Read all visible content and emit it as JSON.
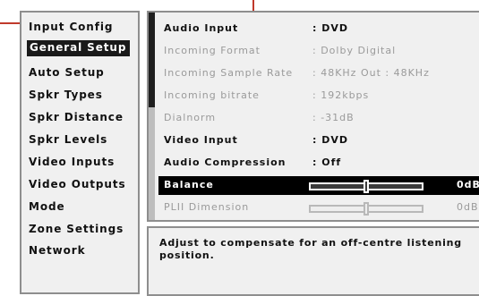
{
  "menu": {
    "items": [
      {
        "label": "Input Config"
      },
      {
        "label": "General Setup"
      },
      {
        "label": "Auto Setup"
      },
      {
        "label": "Spkr Types"
      },
      {
        "label": "Spkr Distance"
      },
      {
        "label": "Spkr Levels"
      },
      {
        "label": "Video Inputs"
      },
      {
        "label": "Video Outputs"
      },
      {
        "label": "Mode"
      },
      {
        "label": "Zone Settings"
      },
      {
        "label": "Network"
      }
    ],
    "selected": "General Setup"
  },
  "settings": {
    "rows": [
      {
        "label": "Audio Input",
        "value": ": DVD",
        "state": "active"
      },
      {
        "label": "Incoming Format",
        "value": ": Dolby Digital",
        "state": "dim"
      },
      {
        "label": "Incoming Sample Rate",
        "value": ": 48KHz Out : 48KHz",
        "state": "dim"
      },
      {
        "label": "Incoming bitrate",
        "value": ": 192kbps",
        "state": "dim"
      },
      {
        "label": "Dialnorm",
        "value": ": -31dB",
        "state": "dim"
      },
      {
        "label": "Video Input",
        "value": ": DVD",
        "state": "active"
      },
      {
        "label": "Audio Compression",
        "value": ": Off",
        "state": "active"
      },
      {
        "label": "Balance",
        "value": "0dB",
        "state": "selected",
        "slider_position": 0.5
      },
      {
        "label": "PLII Dimension",
        "value": "0dB",
        "state": "dim",
        "slider_position": 0.5
      }
    ]
  },
  "help": {
    "text": "Adjust to compensate for an off-centre listening position."
  },
  "colors": {
    "callout": "#c0392b",
    "selected_bg": "#000000",
    "panel_bg": "#f0f0f0"
  }
}
